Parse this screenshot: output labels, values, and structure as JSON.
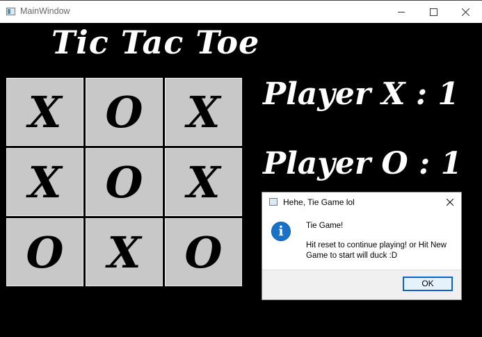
{
  "window": {
    "title": "MainWindow"
  },
  "game": {
    "title": "Tic Tac Toe",
    "board": [
      [
        "X",
        "O",
        "X"
      ],
      [
        "X",
        "O",
        "X"
      ],
      [
        "O",
        "X",
        "O"
      ]
    ],
    "score_x_label": "Player X : 1",
    "score_o_label": "Player O : 1"
  },
  "dialog": {
    "title": "Hehe, Tie Game lol",
    "heading": "Tie Game!",
    "message": "Hit reset to continue playing! or Hit New Game to start will duck :D",
    "ok_label": "OK"
  },
  "icons": {
    "app": "app-window-icon",
    "minimize": "minimize-icon",
    "maximize": "maximize-icon",
    "close": "close-icon",
    "info": "info-icon"
  },
  "colors": {
    "background": "#000000",
    "cell": "#c8c8c8",
    "info_blue": "#1a72c8",
    "button_border": "#0a63c7"
  }
}
